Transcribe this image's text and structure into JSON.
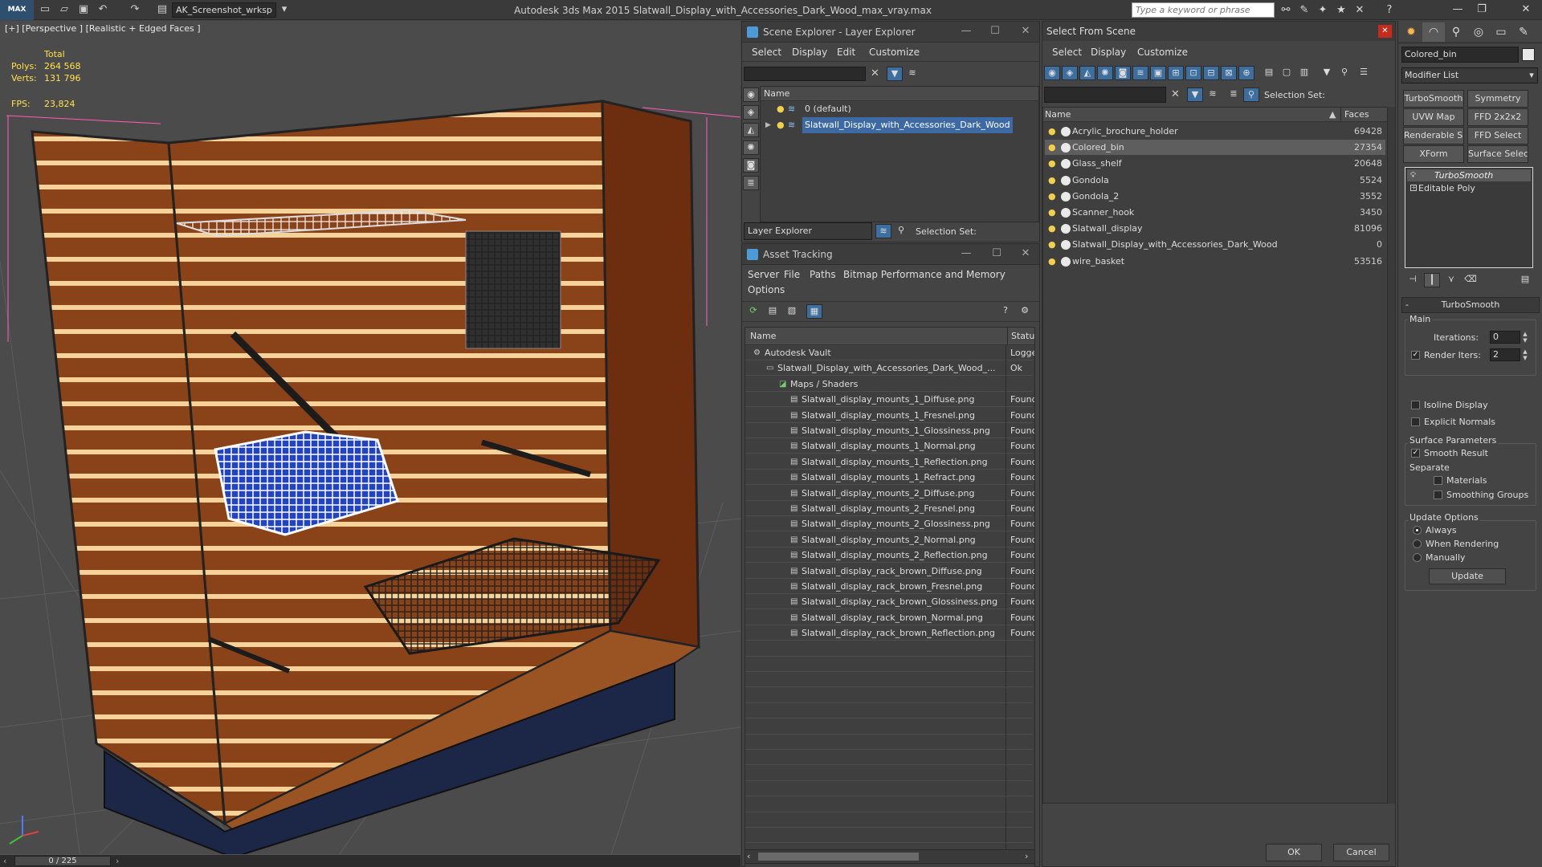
{
  "titlebar": {
    "logo": "MAX",
    "workspace": "AK_Screenshot_wrksp",
    "app_title": "Autodesk 3ds Max  2015     Slatwall_Display_with_Accessories_Dark_Wood_max_vray.max",
    "search_placeholder": "Type a keyword or phrase"
  },
  "viewport": {
    "label": "[+] [Perspective ] [Realistic + Edged Faces ]",
    "stats": {
      "total_label": "Total",
      "polys_label": "Polys:",
      "polys": "264 568",
      "verts_label": "Verts:",
      "verts": "131 796",
      "fps_label": "FPS:",
      "fps": "23,824"
    },
    "frame": "0 / 225"
  },
  "scene_explorer": {
    "title": "Scene Explorer - Layer Explorer",
    "menu": [
      "Select",
      "Display",
      "Edit",
      "Customize"
    ],
    "col_name": "Name",
    "layers": [
      {
        "name": "0 (default)",
        "selected": false
      },
      {
        "name": "Slatwall_Display_with_Accessories_Dark_Wood",
        "selected": true
      }
    ],
    "footer_dropdown": "Layer Explorer",
    "selection_set": "Selection Set:"
  },
  "asset_tracking": {
    "title": "Asset Tracking",
    "menu": [
      "Server",
      "File",
      "Paths",
      "Bitmap Performance and Memory"
    ],
    "menu2": "Options",
    "col_name": "Name",
    "col_status": "Status",
    "rows": [
      {
        "name": "Autodesk Vault",
        "status": "Logged",
        "level": 0
      },
      {
        "name": "Slatwall_Display_with_Accessories_Dark_Wood_...",
        "status": "Ok",
        "level": 1
      },
      {
        "name": "Maps / Shaders",
        "status": "",
        "level": 2
      },
      {
        "name": "Slatwall_display_mounts_1_Diffuse.png",
        "status": "Found",
        "level": 3
      },
      {
        "name": "Slatwall_display_mounts_1_Fresnel.png",
        "status": "Found",
        "level": 3
      },
      {
        "name": "Slatwall_display_mounts_1_Glossiness.png",
        "status": "Found",
        "level": 3
      },
      {
        "name": "Slatwall_display_mounts_1_Normal.png",
        "status": "Found",
        "level": 3
      },
      {
        "name": "Slatwall_display_mounts_1_Reflection.png",
        "status": "Found",
        "level": 3
      },
      {
        "name": "Slatwall_display_mounts_1_Refract.png",
        "status": "Found",
        "level": 3
      },
      {
        "name": "Slatwall_display_mounts_2_Diffuse.png",
        "status": "Found",
        "level": 3
      },
      {
        "name": "Slatwall_display_mounts_2_Fresnel.png",
        "status": "Found",
        "level": 3
      },
      {
        "name": "Slatwall_display_mounts_2_Glossiness.png",
        "status": "Found",
        "level": 3
      },
      {
        "name": "Slatwall_display_mounts_2_Normal.png",
        "status": "Found",
        "level": 3
      },
      {
        "name": "Slatwall_display_mounts_2_Reflection.png",
        "status": "Found",
        "level": 3
      },
      {
        "name": "Slatwall_display_rack_brown_Diffuse.png",
        "status": "Found",
        "level": 3
      },
      {
        "name": "Slatwall_display_rack_brown_Fresnel.png",
        "status": "Found",
        "level": 3
      },
      {
        "name": "Slatwall_display_rack_brown_Glossiness.png",
        "status": "Found",
        "level": 3
      },
      {
        "name": "Slatwall_display_rack_brown_Normal.png",
        "status": "Found",
        "level": 3
      },
      {
        "name": "Slatwall_display_rack_brown_Reflection.png",
        "status": "Found",
        "level": 3
      }
    ]
  },
  "select_from_scene": {
    "title": "Select From Scene",
    "menu": [
      "Select",
      "Display",
      "Customize"
    ],
    "selection_set": "Selection Set:",
    "col_name": "Name",
    "col_faces": "Faces",
    "rows": [
      {
        "name": "Acrylic_brochure_holder",
        "faces": "69428",
        "selected": false
      },
      {
        "name": "Colored_bin",
        "faces": "27354",
        "selected": true
      },
      {
        "name": "Glass_shelf",
        "faces": "20648",
        "selected": false
      },
      {
        "name": "Gondola",
        "faces": "5524",
        "selected": false
      },
      {
        "name": "Gondola_2",
        "faces": "3552",
        "selected": false
      },
      {
        "name": "Scanner_hook",
        "faces": "3450",
        "selected": false
      },
      {
        "name": "Slatwall_display",
        "faces": "81096",
        "selected": false
      },
      {
        "name": "Slatwall_Display_with_Accessories_Dark_Wood",
        "faces": "0",
        "selected": false
      },
      {
        "name": "wire_basket",
        "faces": "53516",
        "selected": false
      }
    ],
    "ok": "OK",
    "cancel": "Cancel"
  },
  "command_panel": {
    "object_name": "Colored_bin",
    "modifier_list": "Modifier List",
    "mod_buttons": [
      "TurboSmooth",
      "Symmetry",
      "UVW Map",
      "FFD 2x2x2",
      "Renderable Spline",
      "FFD Select",
      "XForm",
      "Surface Select"
    ],
    "stack": [
      "TurboSmooth",
      "Editable Poly"
    ],
    "rollout_title": "TurboSmooth",
    "main_label": "Main",
    "iterations_label": "Iterations:",
    "iterations": "0",
    "render_iters_label": "Render Iters:",
    "render_iters": "2",
    "isoline": "Isoline Display",
    "explicit": "Explicit Normals",
    "surface_params": "Surface Parameters",
    "smooth_result": "Smooth Result",
    "separate": "Separate",
    "materials": "Materials",
    "smoothing_groups": "Smoothing Groups",
    "update_options": "Update Options",
    "always": "Always",
    "when_rendering": "When Rendering",
    "manually": "Manually",
    "update": "Update"
  }
}
